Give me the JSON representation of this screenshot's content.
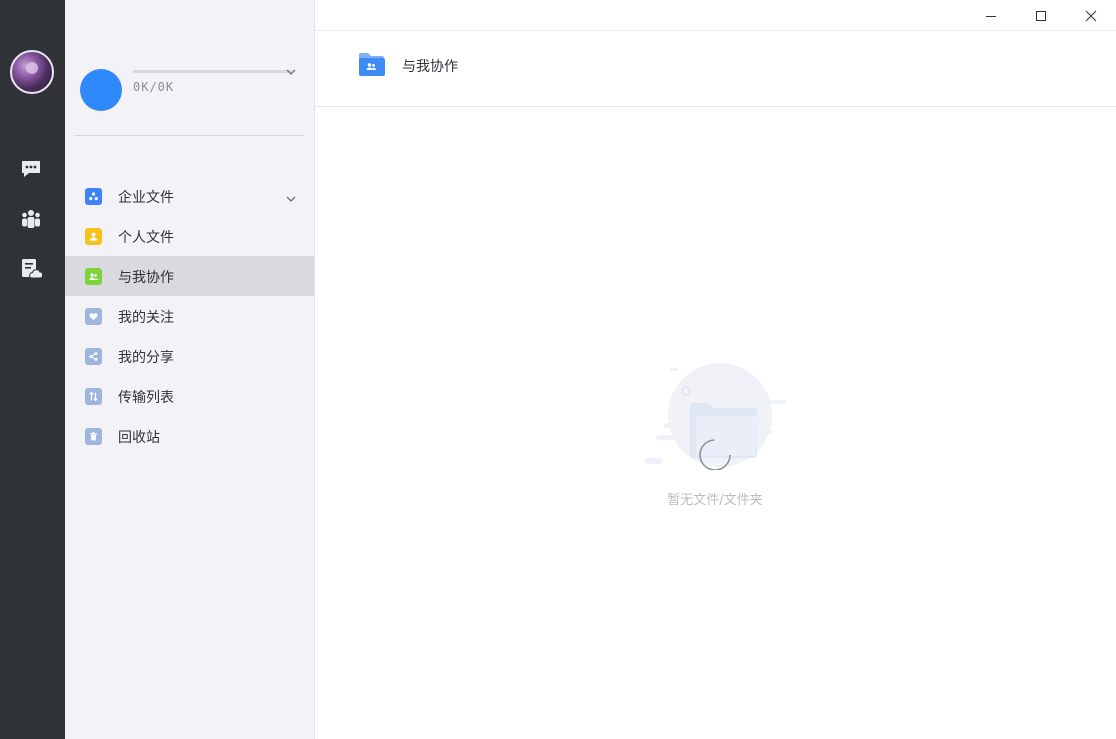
{
  "rail": {
    "avatar": "avatar-photo",
    "icons": [
      "chat-icon",
      "contacts-icon",
      "cloud-document-icon"
    ]
  },
  "sidebar": {
    "quota_text": "0K/0K",
    "items": [
      {
        "label": "企业文件",
        "icon": "enterprise-icon",
        "color": "#3d82f7",
        "expandable": true
      },
      {
        "label": "个人文件",
        "icon": "person-icon",
        "color": "#f7c21b"
      },
      {
        "label": "与我协作",
        "icon": "collaborate-icon",
        "color": "#7dd33a",
        "active": true
      },
      {
        "label": "我的关注",
        "icon": "heart-icon",
        "color": "#9db6dd"
      },
      {
        "label": "我的分享",
        "icon": "share-icon",
        "color": "#9db6dd"
      },
      {
        "label": "传输列表",
        "icon": "transfer-icon",
        "color": "#9db6dd"
      },
      {
        "label": "回收站",
        "icon": "trash-icon",
        "color": "#9db6dd"
      }
    ]
  },
  "header": {
    "title": "与我协作",
    "icon": "folder-icon"
  },
  "empty_state": {
    "text": "暂无文件/文件夹",
    "icon": "empty-folder-illustration"
  },
  "window": {
    "controls": [
      "minimize",
      "maximize",
      "close"
    ]
  }
}
